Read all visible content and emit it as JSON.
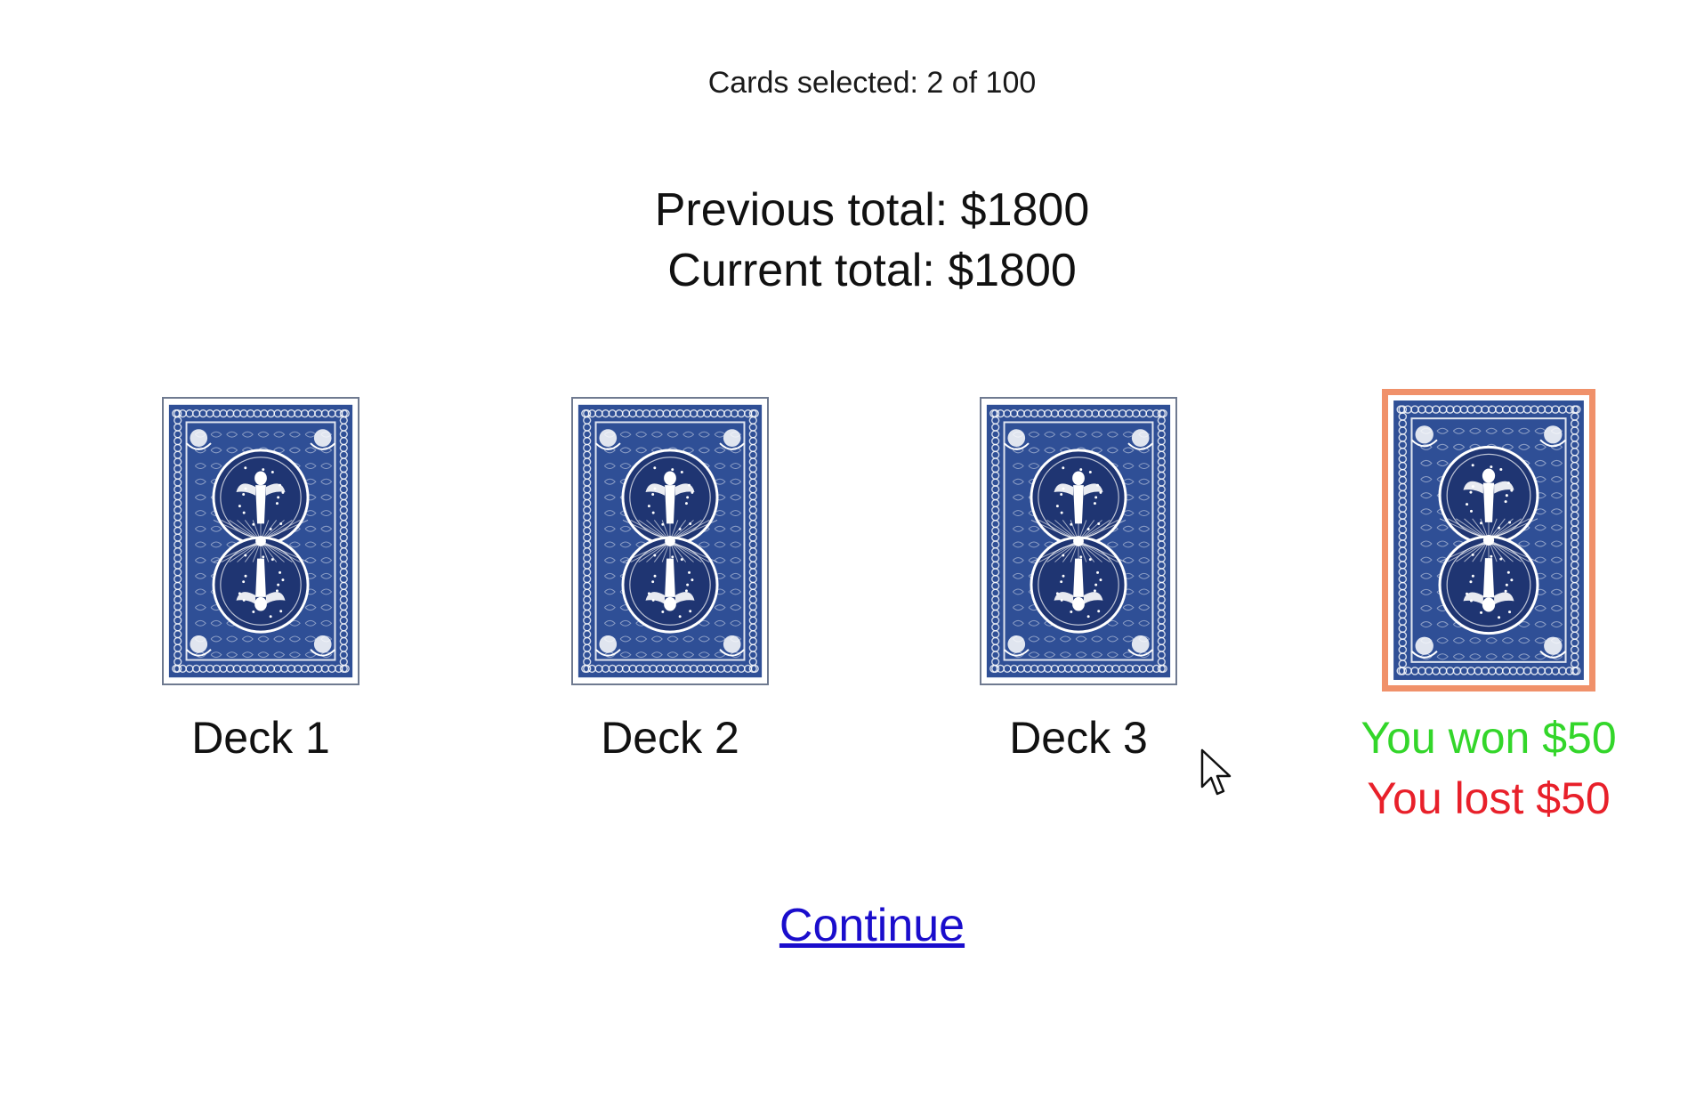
{
  "status": {
    "cards_selected": "Cards selected: 2 of 100"
  },
  "totals": {
    "previous": "Previous total: $1800",
    "current": "Current total: $1800"
  },
  "decks": [
    {
      "label": "Deck 1"
    },
    {
      "label": "Deck 2"
    },
    {
      "label": "Deck 3"
    }
  ],
  "selected_deck": {
    "won": "You won $50",
    "lost": "You lost $50"
  },
  "continue_label": "Continue",
  "colors": {
    "card_blue": "#2f4f96",
    "card_dark": "#1f3572",
    "selected_border": "#f0916a",
    "won": "#33d62a",
    "lost": "#e8202a",
    "link": "#1a0dcc"
  },
  "icons": [
    "card-back-pattern",
    "mouse-pointer-icon"
  ]
}
